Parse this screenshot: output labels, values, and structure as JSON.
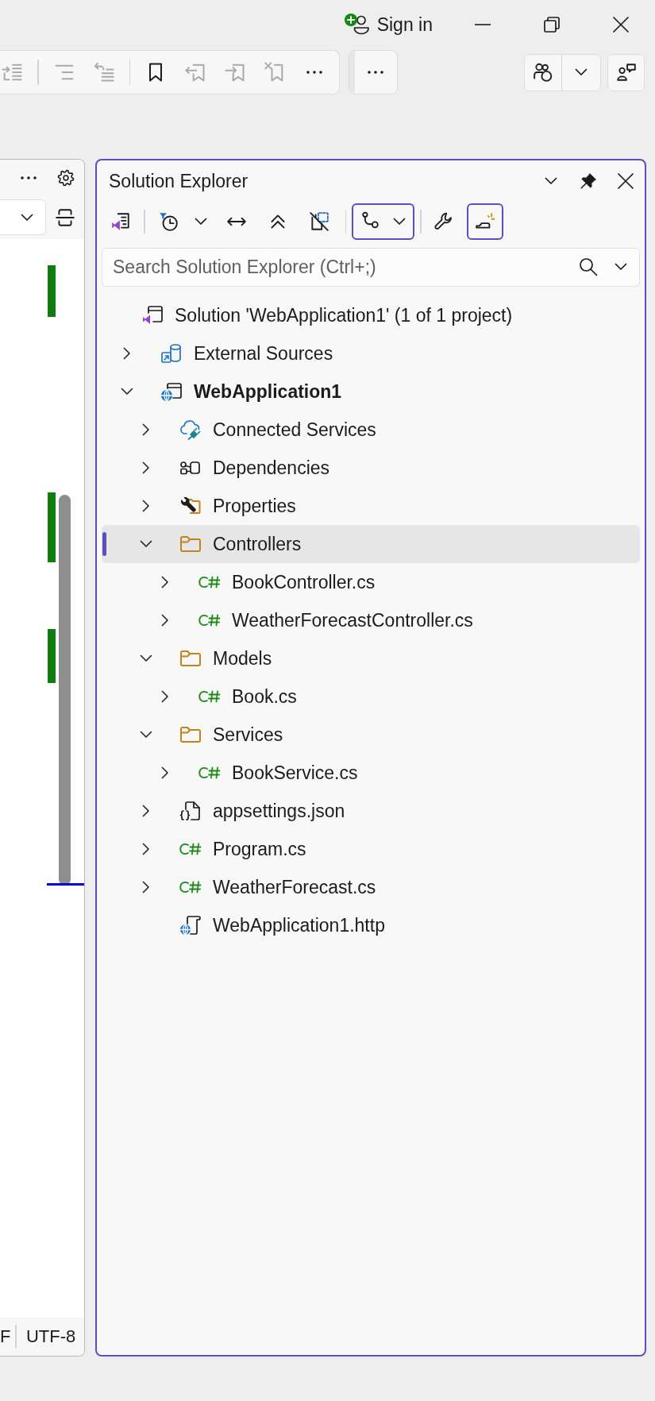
{
  "title_bar": {
    "sign_in": "Sign in"
  },
  "toolbar": {
    "groups": [
      {
        "items": [
          {
            "kind": "arrow-lines",
            "disabled": true
          }
        ]
      },
      {
        "items": [
          {
            "kind": "lines",
            "disabled": true
          },
          {
            "kind": "undo-lines",
            "disabled": true
          }
        ]
      },
      {
        "items": [
          {
            "kind": "bookmark",
            "disabled": false
          },
          {
            "kind": "bookmark-previous",
            "disabled": true
          },
          {
            "kind": "bookmark-next",
            "disabled": true
          },
          {
            "kind": "bookmark-clear",
            "disabled": true
          },
          {
            "kind": "more",
            "disabled": false
          }
        ]
      }
    ]
  },
  "editor": {
    "status_bar": [
      "F",
      "UTF-8"
    ]
  },
  "solution_explorer": {
    "title": "Solution Explorer",
    "toolbar": [
      {
        "kind": "solution-view",
        "on": false
      },
      {
        "kind": "separator"
      },
      {
        "kind": "pending-filter",
        "on": false
      },
      {
        "kind": "dropdown",
        "on": false
      },
      {
        "kind": "sync",
        "on": false
      },
      {
        "kind": "collapse-all",
        "on": false
      },
      {
        "kind": "show-all-files",
        "on": false
      },
      {
        "kind": "separator"
      },
      {
        "kind": "branch-view",
        "on": true
      },
      {
        "kind": "separator"
      },
      {
        "kind": "properties",
        "on": false
      },
      {
        "kind": "preview",
        "on": true
      }
    ],
    "search": {
      "placeholder": "Search Solution Explorer (Ctrl+;)"
    },
    "tree": {
      "label": "Solution 'WebApplication1' (1 of 1 project)",
      "kind": "solution",
      "selected": false,
      "children": [
        {
          "label": "External Sources",
          "kind": "external",
          "expanded": false,
          "selected": false
        },
        {
          "label": "WebApplication1",
          "kind": "project",
          "expanded": true,
          "selected": false,
          "children": [
            {
              "label": "Connected Services",
              "kind": "cloud",
              "expanded": false,
              "selected": false
            },
            {
              "label": "Dependencies",
              "kind": "dependencies",
              "expanded": false,
              "selected": false
            },
            {
              "label": "Properties",
              "kind": "properties",
              "expanded": false,
              "selected": false
            },
            {
              "label": "Controllers",
              "kind": "folder",
              "expanded": true,
              "selected": true,
              "children": [
                {
                  "label": "BookController.cs",
                  "kind": "csharp",
                  "expanded": false,
                  "selected": false
                },
                {
                  "label": "WeatherForecastController.cs",
                  "kind": "csharp",
                  "expanded": false,
                  "selected": false
                }
              ]
            },
            {
              "label": "Models",
              "kind": "folder",
              "expanded": true,
              "selected": false,
              "children": [
                {
                  "label": "Book.cs",
                  "kind": "csharp",
                  "expanded": false,
                  "selected": false
                }
              ]
            },
            {
              "label": "Services",
              "kind": "folder",
              "expanded": true,
              "selected": false,
              "children": [
                {
                  "label": "BookService.cs",
                  "kind": "csharp",
                  "expanded": false,
                  "selected": false
                }
              ]
            },
            {
              "label": "appsettings.json",
              "kind": "json",
              "expanded": false,
              "selected": false
            },
            {
              "label": "Program.cs",
              "kind": "csharp",
              "expanded": false,
              "selected": false
            },
            {
              "label": "WeatherForecast.cs",
              "kind": "csharp",
              "expanded": false,
              "selected": false
            },
            {
              "label": "WebApplication1.http",
              "kind": "http",
              "selected": false
            }
          ]
        }
      ]
    }
  }
}
